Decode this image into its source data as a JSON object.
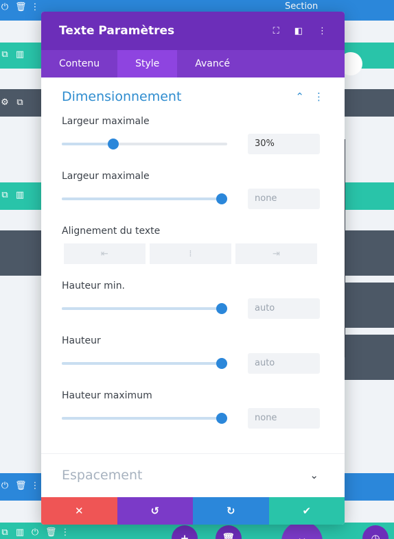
{
  "section_label": "Section",
  "modal": {
    "title": "Texte Paramètres",
    "tabs": [
      "Contenu",
      "Style",
      "Avancé"
    ],
    "active_tab": "Style",
    "section_title": "Dimensionnement",
    "fields": [
      {
        "label": "Largeur maximale",
        "value": "30%",
        "slider_percent": 31,
        "placeholder": false
      },
      {
        "label": "Largeur maximale",
        "value": "none",
        "slider_percent": 100,
        "placeholder": true
      },
      {
        "label": "Hauteur min.",
        "value": "auto",
        "slider_percent": 100,
        "placeholder": true
      },
      {
        "label": "Hauteur",
        "value": "auto",
        "slider_percent": 100,
        "placeholder": true
      },
      {
        "label": "Hauteur maximum",
        "value": "none",
        "slider_percent": 100,
        "placeholder": true
      }
    ],
    "align_label": "Alignement du texte",
    "next_section_title": "Espacement"
  },
  "colors": {
    "header": "#6c2eb9",
    "tabs": "#7b3ac8",
    "active_tab": "#8e44e0",
    "accent_blue": "#2e8ccf",
    "teal": "#29c4a9",
    "red": "#ef5555",
    "dark_row": "#4c5866"
  },
  "icons": {
    "header": [
      "focus-icon",
      "split-view-icon",
      "kebab-menu-icon"
    ],
    "footer": [
      "close-icon",
      "undo-icon",
      "redo-icon",
      "checkmark-icon"
    ],
    "align": [
      "align-left-icon",
      "align-center-icon",
      "align-right-icon"
    ]
  }
}
